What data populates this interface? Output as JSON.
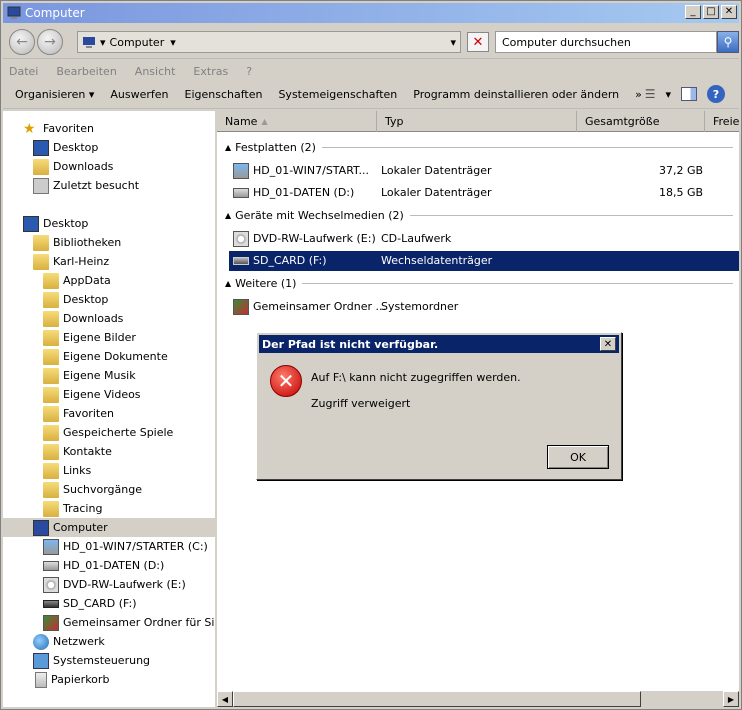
{
  "window": {
    "title": "Computer"
  },
  "address": {
    "path": "Computer",
    "search_placeholder": "Computer durchsuchen"
  },
  "menu": [
    "Datei",
    "Bearbeiten",
    "Ansicht",
    "Extras",
    "?"
  ],
  "commands": {
    "organize": "Organisieren",
    "eject": "Auswerfen",
    "properties": "Eigenschaften",
    "system_properties": "Systemeigenschaften",
    "uninstall": "Programm deinstallieren oder ändern",
    "more": "»"
  },
  "sidebar": {
    "favorites": "Favoriten",
    "fav_items": [
      "Desktop",
      "Downloads",
      "Zuletzt besucht"
    ],
    "desktop": "Desktop",
    "libraries": "Bibliotheken",
    "user": "Karl-Heinz",
    "user_items": [
      "AppData",
      "Desktop",
      "Downloads",
      "Eigene Bilder",
      "Eigene Dokumente",
      "Eigene Musik",
      "Eigene Videos",
      "Favoriten",
      "Gespeicherte Spiele",
      "Kontakte",
      "Links",
      "Suchvorgänge",
      "Tracing"
    ],
    "computer": "Computer",
    "computer_items": [
      "HD_01-WIN7/STARTER (C:)",
      "HD_01-DATEN (D:)",
      "DVD-RW-Laufwerk (E:)",
      "SD_CARD (F:)",
      "Gemeinsamer Ordner für Sicher"
    ],
    "network": "Netzwerk",
    "control_panel": "Systemsteuerung",
    "recycle_bin": "Papierkorb"
  },
  "columns": [
    "Name",
    "Typ",
    "Gesamtgröße",
    "Freier"
  ],
  "groups": {
    "hdd": "Festplatten (2)",
    "removable": "Geräte mit Wechselmedien (2)",
    "other": "Weitere (1)"
  },
  "rows": [
    {
      "name": "HD_01-WIN7/START...",
      "type": "Lokaler Datenträger",
      "size": "37,2 GB"
    },
    {
      "name": "HD_01-DATEN (D:)",
      "type": "Lokaler Datenträger",
      "size": "18,5 GB"
    },
    {
      "name": "DVD-RW-Laufwerk (E:)",
      "type": "CD-Laufwerk",
      "size": ""
    },
    {
      "name": "SD_CARD (F:)",
      "type": "Wechseldatenträger",
      "size": ""
    },
    {
      "name": "Gemeinsamer Ordner ...",
      "type": "Systemordner",
      "size": ""
    }
  ],
  "dialog": {
    "title": "Der Pfad ist nicht verfügbar.",
    "message": "Auf F:\\ kann nicht zugegriffen werden.",
    "detail": "Zugriff verweigert",
    "ok": "OK"
  }
}
